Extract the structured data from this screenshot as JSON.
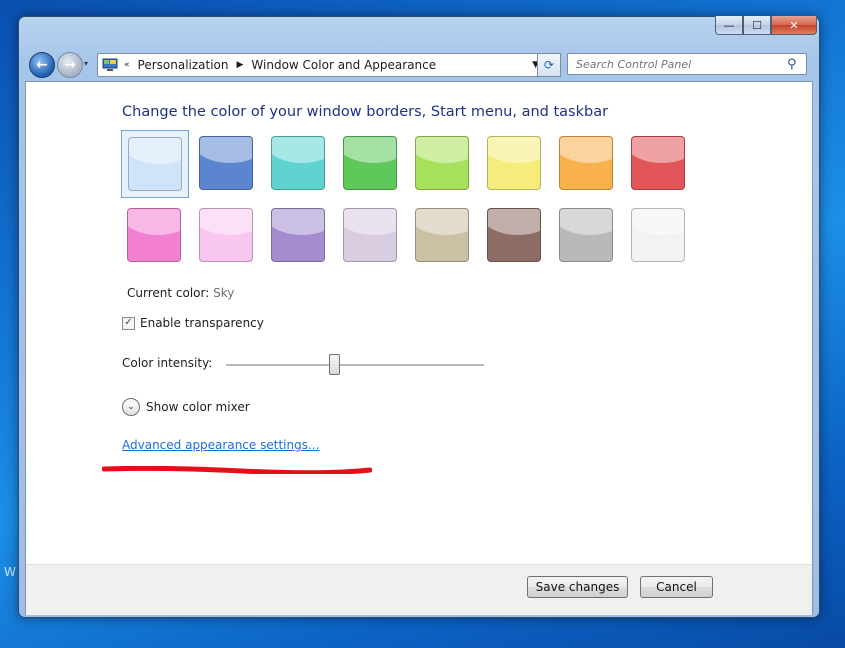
{
  "desktop": {
    "edge_text": "W"
  },
  "window": {
    "caption": {
      "minimize": "—",
      "maximize": "☐",
      "close": "✕"
    }
  },
  "navbar": {
    "history_chevron": "▾",
    "address": {
      "overflow": "«",
      "crumbs": [
        "Personalization",
        "Window Color and Appearance"
      ],
      "separator": "▶",
      "dropdown": "▼"
    },
    "refresh": "⟳",
    "search": {
      "placeholder": "Search Control Panel",
      "value": ""
    }
  },
  "main": {
    "heading": "Change the color of your window borders, Start menu, and taskbar",
    "swatches": [
      {
        "color": "#cfe3fb",
        "selected": true
      },
      {
        "color": "#5b86cf"
      },
      {
        "color": "#5fd3d0"
      },
      {
        "color": "#5ec85a"
      },
      {
        "color": "#a7e05a"
      },
      {
        "color": "#f6ec7c"
      },
      {
        "color": "#f8b14d"
      },
      {
        "color": "#e25558"
      },
      {
        "color": "#f27fcf"
      },
      {
        "color": "#f8c6ee"
      },
      {
        "color": "#a48ccf"
      },
      {
        "color": "#d9cde2"
      },
      {
        "color": "#cbbfa4"
      },
      {
        "color": "#8d6c66"
      },
      {
        "color": "#b9b9b9"
      },
      {
        "color": "#f2f2f2"
      }
    ],
    "current_color_label": "Current color:",
    "current_color_value": "Sky",
    "transparency": {
      "label": "Enable transparency",
      "checked": true,
      "check_glyph": "✓"
    },
    "intensity": {
      "label": "Color intensity:",
      "value_fraction": 0.42
    },
    "mixer": {
      "label": "Show color mixer",
      "glyph": "⌄"
    },
    "advanced_link": "Advanced appearance settings...",
    "annotation_color": "#e3101a"
  },
  "footer": {
    "save": "Save changes",
    "cancel": "Cancel"
  }
}
